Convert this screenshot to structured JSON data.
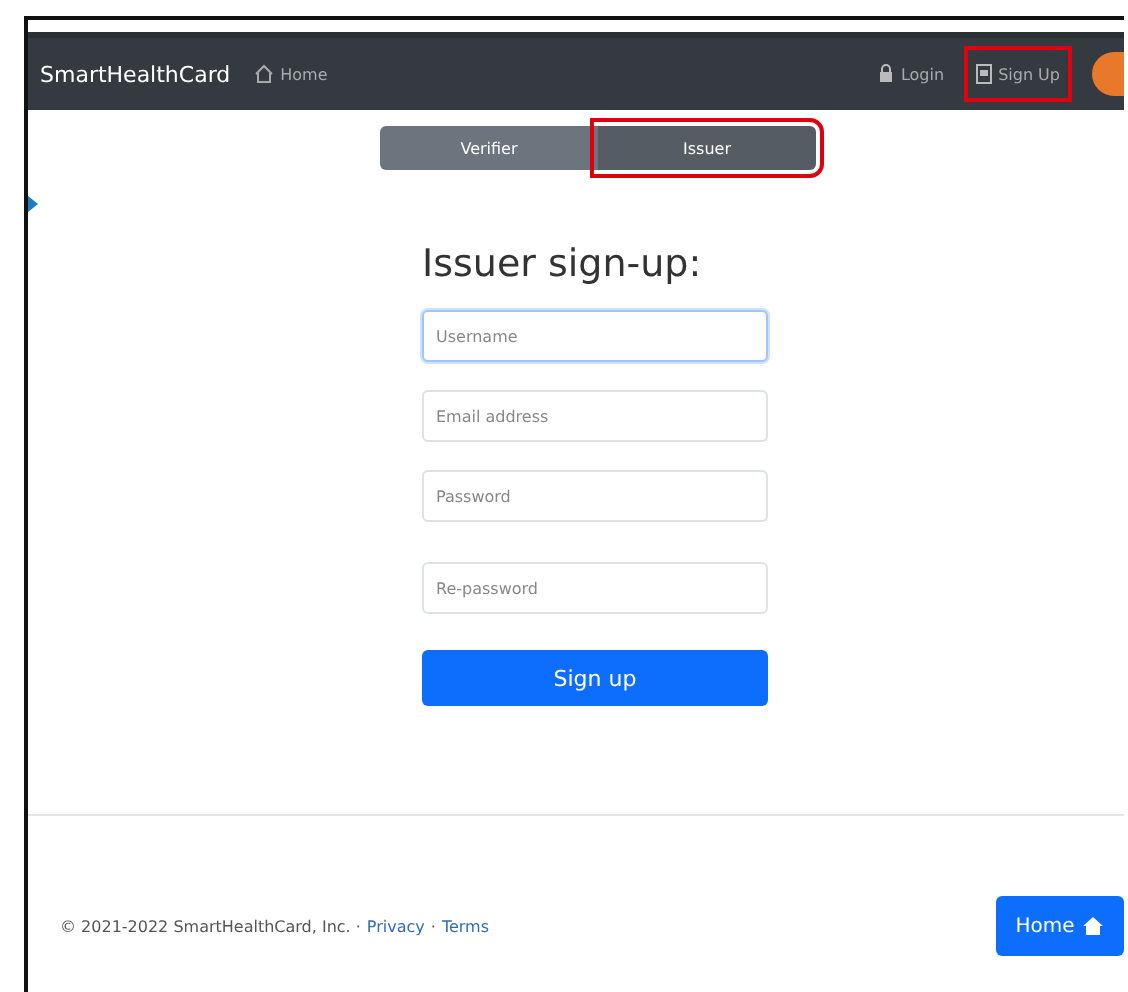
{
  "navbar": {
    "brand": "SmartHealthCard",
    "links": [
      {
        "label": "Home",
        "kind": "home"
      }
    ],
    "right_links": [
      {
        "label": "Login",
        "kind": "login",
        "highlighted": false
      },
      {
        "label": "Sign Up",
        "kind": "signup",
        "highlighted": true
      }
    ]
  },
  "tabs": [
    {
      "label": "Verifier",
      "selected": false,
      "highlighted": false
    },
    {
      "label": "Issuer",
      "selected": true,
      "highlighted": true
    }
  ],
  "form": {
    "title": "Issuer sign-up:",
    "fields": [
      {
        "placeholder": "Username",
        "focused": true
      },
      {
        "placeholder": "Email address",
        "focused": false
      },
      {
        "placeholder": "Password",
        "focused": false
      },
      {
        "placeholder": "Re-password",
        "focused": false
      }
    ],
    "submit": "Sign up"
  },
  "footer": {
    "copyright": "© 2021-2022 SmartHealthCard, Inc. ·",
    "links": [
      {
        "label": "Privacy"
      },
      {
        "separator": "·",
        "label": "Terms"
      }
    ],
    "home_button": "Home"
  }
}
